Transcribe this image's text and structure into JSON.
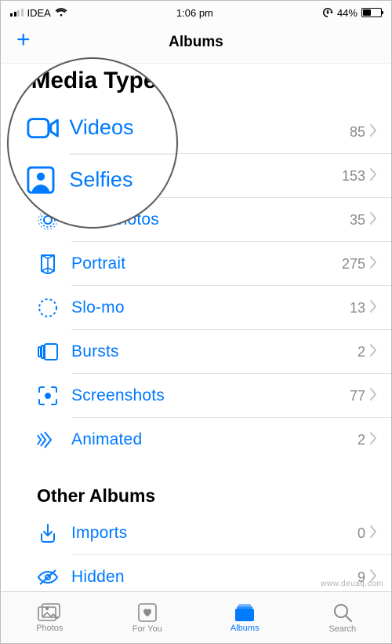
{
  "statusbar": {
    "carrier": "IDEA",
    "time": "1:06 pm",
    "battery_pct": "44%"
  },
  "navbar": {
    "title": "Albums",
    "add_label": "+"
  },
  "colors": {
    "accent": "#007aff",
    "secondary": "#8a8a8e"
  },
  "magnifier": {
    "header": "Media Types",
    "row1_label": "Videos",
    "row2_label": "Selfies"
  },
  "media_types": {
    "header": "Media Types",
    "rows": [
      {
        "icon": "video-icon",
        "label": "Videos",
        "count": "85"
      },
      {
        "icon": "selfie-icon",
        "label": "Selfies",
        "count": "153"
      },
      {
        "icon": "livephoto-icon",
        "label": "Live Photos",
        "count": "35"
      },
      {
        "icon": "portrait-icon",
        "label": "Portrait",
        "count": "275"
      },
      {
        "icon": "slomo-icon",
        "label": "Slo-mo",
        "count": "13"
      },
      {
        "icon": "bursts-icon",
        "label": "Bursts",
        "count": "2"
      },
      {
        "icon": "screenshot-icon",
        "label": "Screenshots",
        "count": "77"
      },
      {
        "icon": "animated-icon",
        "label": "Animated",
        "count": "2"
      }
    ]
  },
  "other_albums": {
    "header": "Other Albums",
    "rows": [
      {
        "icon": "imports-icon",
        "label": "Imports",
        "count": "0"
      },
      {
        "icon": "hidden-icon",
        "label": "Hidden",
        "count": "9"
      }
    ]
  },
  "tabs": {
    "photos": "Photos",
    "foryou": "For You",
    "albums": "Albums",
    "search": "Search"
  },
  "watermark": "www.deuaq.com"
}
